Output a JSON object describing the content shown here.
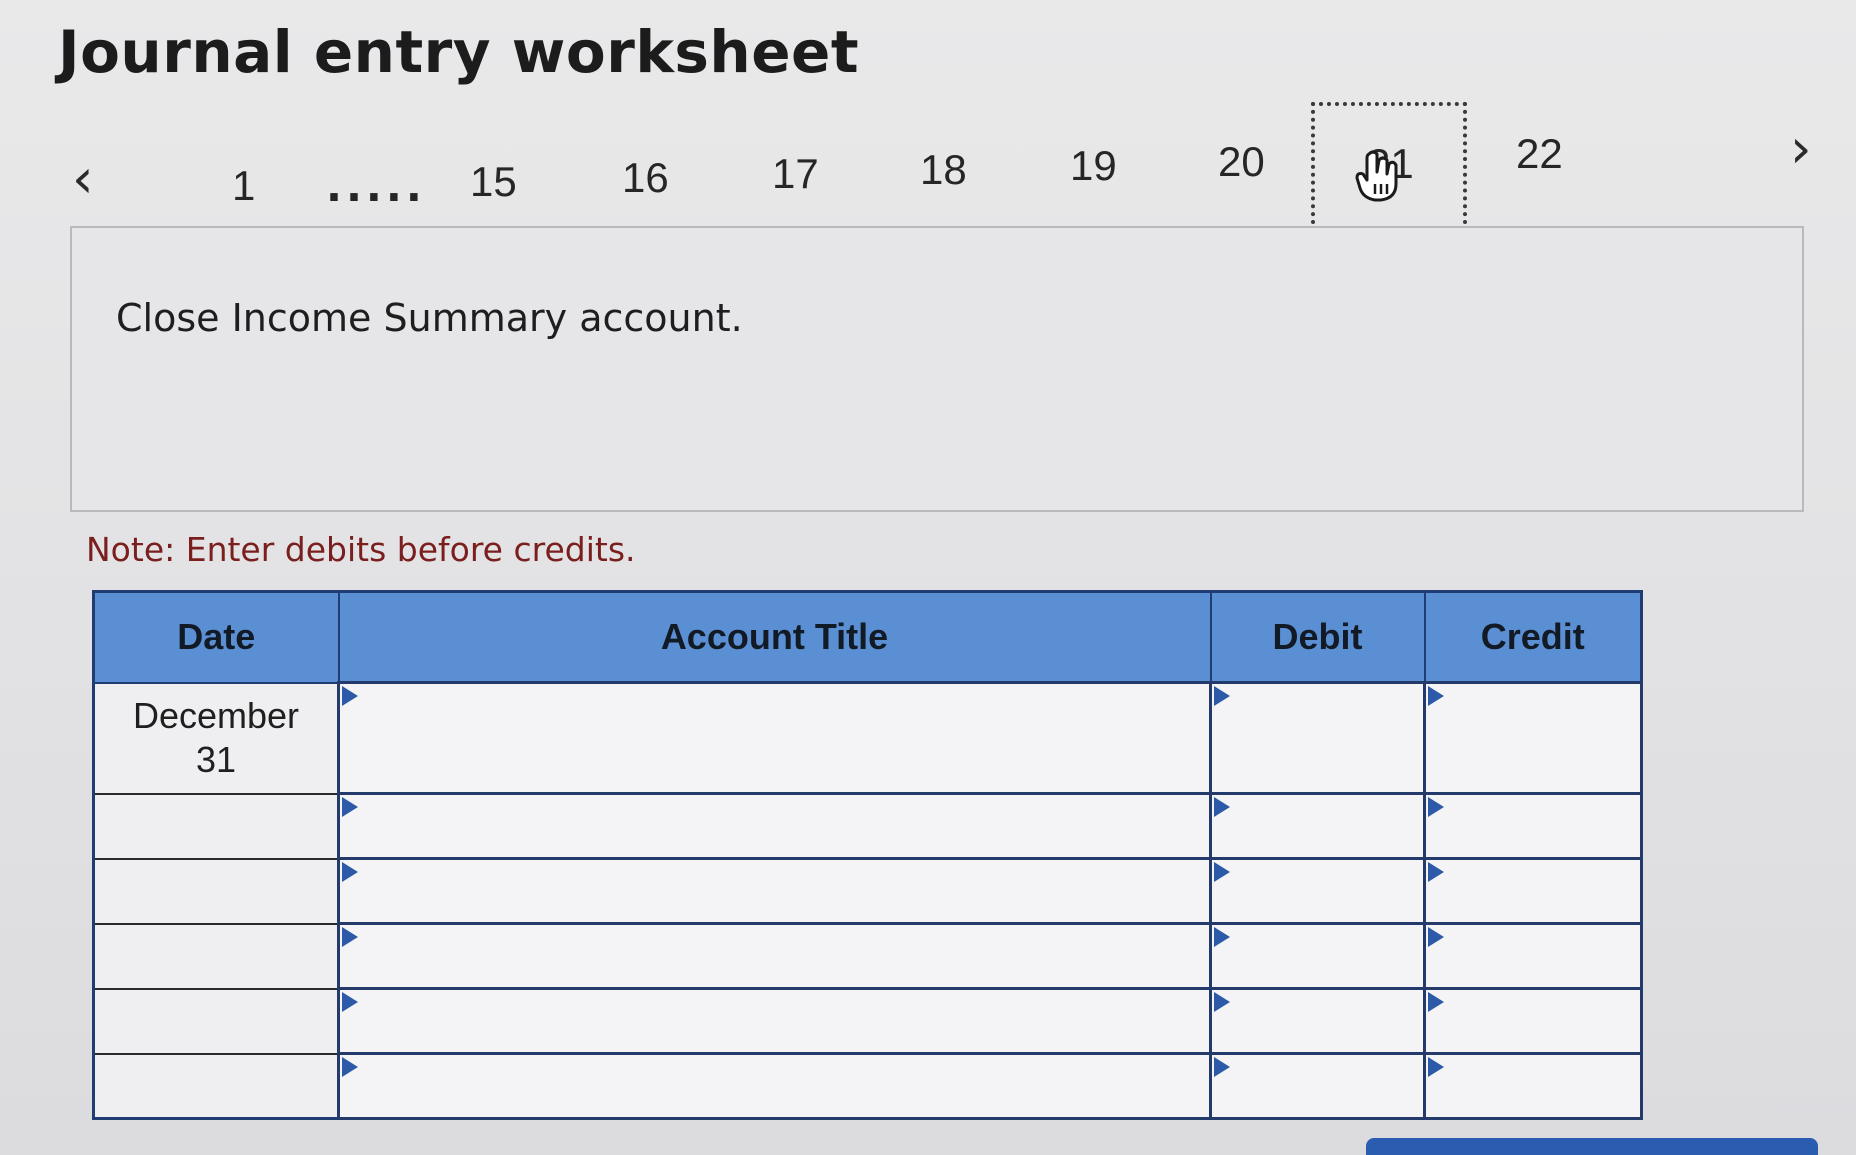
{
  "title": "Journal entry worksheet",
  "pager": {
    "prev_icon": "chevron-left-icon",
    "next_icon": "chevron-right-icon",
    "first": "1",
    "ellipsis": ".....",
    "pages": [
      "15",
      "16",
      "17",
      "18",
      "19",
      "20"
    ],
    "current": "21",
    "after": "22"
  },
  "question": {
    "text": "Close Income Summary account."
  },
  "note": "Note: Enter debits before credits.",
  "journal": {
    "headers": {
      "date": "Date",
      "account": "Account Title",
      "debit": "Debit",
      "credit": "Credit"
    },
    "first_row_date_line1": "December",
    "first_row_date_line2": "31",
    "rows": 6
  },
  "colors": {
    "header_bg": "#5b8fd3",
    "table_border": "#1f3d73",
    "note_text": "#7a1e1e",
    "marker": "#2d5aa8"
  }
}
